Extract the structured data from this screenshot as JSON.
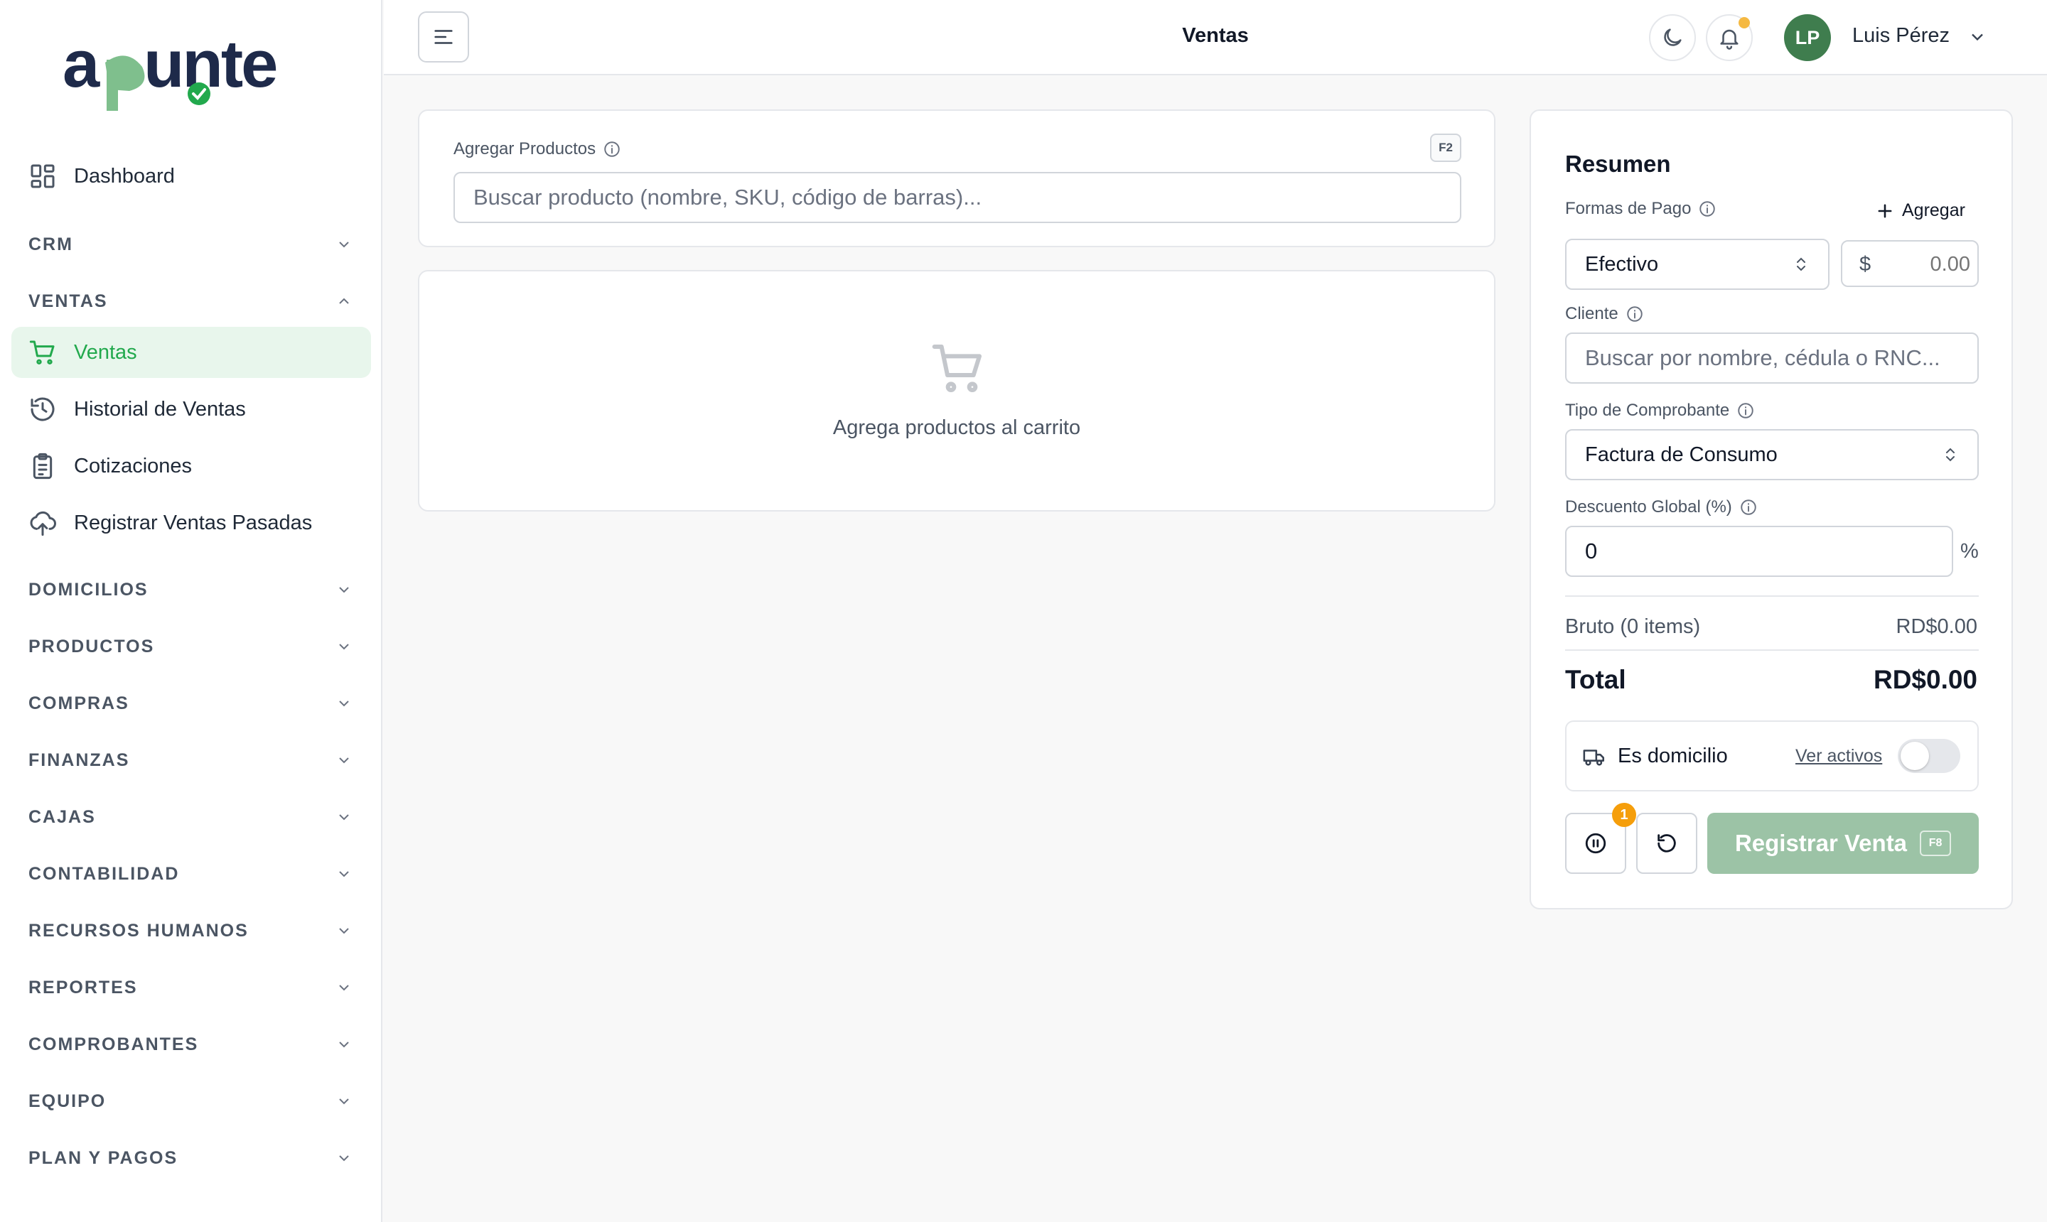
{
  "app": {
    "logo_text": "apunte",
    "brand_color": "#22a94d"
  },
  "sidebar": {
    "items": [
      {
        "label": "Dashboard",
        "icon": "dashboard-grid-icon"
      },
      {
        "label": "Ventas",
        "icon": "cart-icon",
        "active": true
      },
      {
        "label": "Historial de Ventas",
        "icon": "history-icon"
      },
      {
        "label": "Cotizaciones",
        "icon": "clipboard-list-icon"
      },
      {
        "label": "Registrar Ventas Pasadas",
        "icon": "cloud-upload-icon"
      }
    ],
    "sections": [
      {
        "label": "CRM",
        "expanded": false
      },
      {
        "label": "VENTAS",
        "expanded": true
      },
      {
        "label": "DOMICILIOS",
        "expanded": false
      },
      {
        "label": "PRODUCTOS",
        "expanded": false
      },
      {
        "label": "COMPRAS",
        "expanded": false
      },
      {
        "label": "FINANZAS",
        "expanded": false
      },
      {
        "label": "CAJAS",
        "expanded": false
      },
      {
        "label": "CONTABILIDAD",
        "expanded": false
      },
      {
        "label": "RECURSOS HUMANOS",
        "expanded": false
      },
      {
        "label": "REPORTES",
        "expanded": false
      },
      {
        "label": "COMPROBANTES",
        "expanded": false
      },
      {
        "label": "EQUIPO",
        "expanded": false
      },
      {
        "label": "PLAN Y PAGOS",
        "expanded": false
      }
    ]
  },
  "header": {
    "title": "Ventas",
    "user": {
      "initials": "LP",
      "name": "Luis Pérez"
    }
  },
  "products": {
    "label": "Agregar Productos",
    "shortcut": "F2",
    "search_placeholder": "Buscar producto (nombre, SKU, código de barras)..."
  },
  "cart": {
    "empty_text": "Agrega productos al carrito"
  },
  "summary": {
    "title": "Resumen",
    "payment_label": "Formas de Pago",
    "add_label": "Agregar",
    "payment_method": "Efectivo",
    "currency_symbol": "$",
    "amount_placeholder": "0.00",
    "client_label": "Cliente",
    "client_placeholder": "Buscar por nombre, cédula o RNC...",
    "voucher_label": "Tipo de Comprobante",
    "voucher_value": "Factura de Consumo",
    "discount_label": "Descuento Global (%)",
    "discount_value": "0",
    "percent_symbol": "%",
    "gross_label": "Bruto (0 items)",
    "gross_value": "RD$0.00",
    "total_label": "Total",
    "total_value": "RD$0.00",
    "delivery_label": "Es domicilio",
    "delivery_link": "Ver activos",
    "delivery_on": false,
    "held_count": "1",
    "register_label": "Registrar Venta",
    "register_shortcut": "F8"
  }
}
